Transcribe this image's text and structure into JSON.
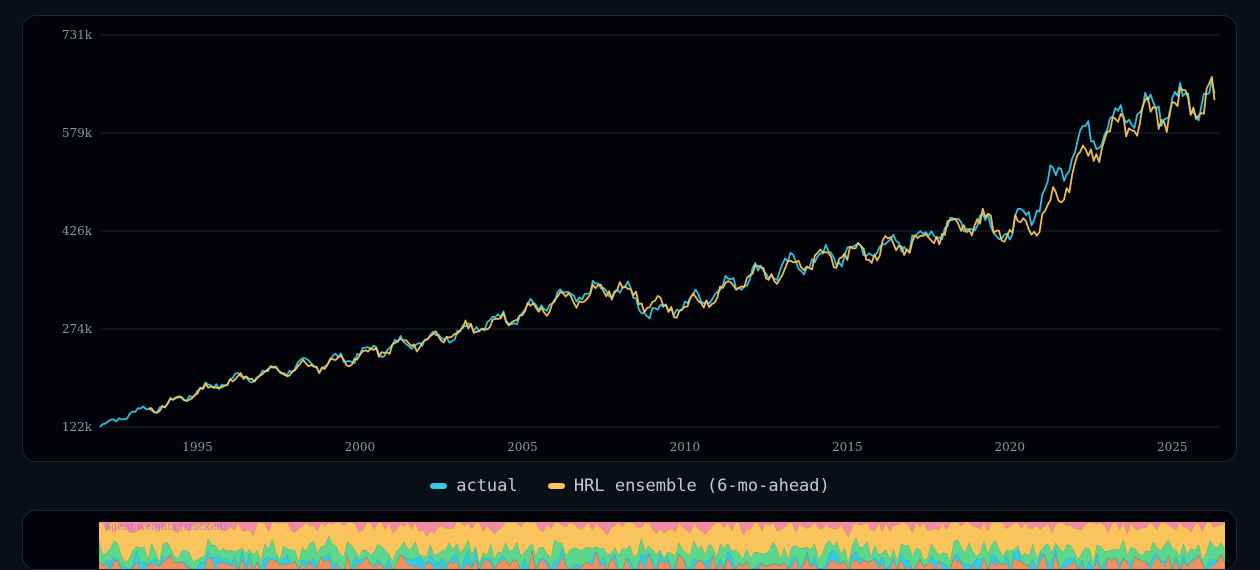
{
  "chart_data": {
    "type": "line",
    "title": "",
    "xlabel": "",
    "ylabel": "",
    "xlim": [
      1992,
      2026.5
    ],
    "ylim": [
      122000,
      731000
    ],
    "x_ticks": [
      "1995",
      "2000",
      "2005",
      "2010",
      "2015",
      "2020",
      "2025"
    ],
    "y_ticks": [
      "122k",
      "274k",
      "426k",
      "579k",
      "731k"
    ],
    "grid": "horizontal",
    "legend_position": "bottom-center",
    "series": [
      {
        "name": "actual",
        "color": "#35c9e8",
        "points": [
          [
            1992.0,
            122000
          ],
          [
            1993.0,
            145000
          ],
          [
            1994.0,
            155000
          ],
          [
            1995.0,
            178000
          ],
          [
            1996.0,
            195000
          ],
          [
            1997.0,
            205000
          ],
          [
            1998.0,
            215000
          ],
          [
            1999.0,
            222000
          ],
          [
            2000.0,
            235000
          ],
          [
            2001.0,
            248000
          ],
          [
            2002.0,
            258000
          ],
          [
            2003.0,
            270000
          ],
          [
            2004.0,
            285000
          ],
          [
            2005.0,
            300000
          ],
          [
            2006.0,
            318000
          ],
          [
            2007.0,
            330000
          ],
          [
            2008.0,
            338000
          ],
          [
            2009.0,
            300000
          ],
          [
            2010.0,
            312000
          ],
          [
            2011.0,
            335000
          ],
          [
            2012.0,
            358000
          ],
          [
            2013.0,
            368000
          ],
          [
            2014.0,
            382000
          ],
          [
            2015.0,
            392000
          ],
          [
            2016.0,
            400000
          ],
          [
            2017.0,
            412000
          ],
          [
            2018.0,
            432000
          ],
          [
            2019.0,
            445000
          ],
          [
            2020.0,
            420000
          ],
          [
            2021.0,
            480000
          ],
          [
            2022.0,
            560000
          ],
          [
            2023.0,
            595000
          ],
          [
            2024.0,
            612000
          ],
          [
            2025.0,
            625000
          ],
          [
            2026.3,
            640000
          ]
        ]
      },
      {
        "name": "HRL ensemble (6-mo-ahead)",
        "color": "#f9c45c",
        "points": [
          [
            1993.5,
            150000
          ],
          [
            1994.0,
            155000
          ],
          [
            1995.0,
            176000
          ],
          [
            1996.0,
            193000
          ],
          [
            1997.0,
            203000
          ],
          [
            1998.0,
            213000
          ],
          [
            1999.0,
            220000
          ],
          [
            2000.0,
            232000
          ],
          [
            2001.0,
            246000
          ],
          [
            2002.0,
            256000
          ],
          [
            2003.0,
            268000
          ],
          [
            2004.0,
            282000
          ],
          [
            2005.0,
            297000
          ],
          [
            2006.0,
            315000
          ],
          [
            2007.0,
            328000
          ],
          [
            2008.0,
            340000
          ],
          [
            2009.0,
            310000
          ],
          [
            2010.0,
            305000
          ],
          [
            2011.0,
            330000
          ],
          [
            2012.0,
            355000
          ],
          [
            2013.0,
            366000
          ],
          [
            2014.0,
            380000
          ],
          [
            2015.0,
            390000
          ],
          [
            2016.0,
            398000
          ],
          [
            2017.0,
            410000
          ],
          [
            2018.0,
            428000
          ],
          [
            2019.0,
            442000
          ],
          [
            2020.0,
            425000
          ],
          [
            2021.0,
            445000
          ],
          [
            2022.0,
            520000
          ],
          [
            2023.0,
            580000
          ],
          [
            2024.0,
            600000
          ],
          [
            2025.0,
            615000
          ],
          [
            2026.3,
            630000
          ]
        ]
      }
    ]
  },
  "legend": {
    "items": [
      {
        "label": "actual",
        "color": "#35c9e8"
      },
      {
        "label": "HRL ensemble (6-mo-ahead)",
        "color": "#f9c45c"
      }
    ]
  },
  "sub_chart": {
    "type": "area",
    "label": "agent weights (stacked)",
    "colors": [
      "#f48aa8",
      "#f9c45c",
      "#5cd68a",
      "#35c9e8",
      "#f0905c"
    ]
  }
}
